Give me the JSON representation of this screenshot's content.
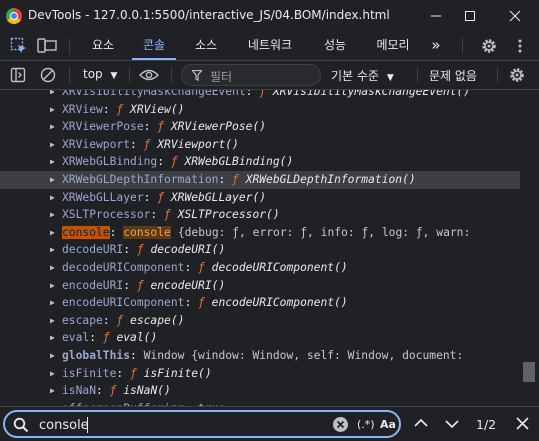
{
  "window": {
    "title": "DevTools - 127.0.0.1:5500/interactive_JS/04.BOM/index.html",
    "icon": "chrome-icon",
    "controls": [
      "minimize-icon",
      "maximize-icon",
      "close-icon"
    ]
  },
  "tabs": {
    "items": [
      {
        "label": "요소",
        "active": false
      },
      {
        "label": "콘솔",
        "active": true
      },
      {
        "label": "소스",
        "active": false
      },
      {
        "label": "네트워크",
        "active": false
      },
      {
        "label": "성능",
        "active": false
      },
      {
        "label": "메모리",
        "active": false
      }
    ],
    "more": "»"
  },
  "toolbar": {
    "context": "top",
    "filter_placeholder": "필터",
    "levels": "기본 수준",
    "issues": "문제 없음"
  },
  "console_rows": [
    {
      "name": "XRVisibilityMaskChangeEvent",
      "fn": "XRVisibilityMaskChangeEvent()",
      "partial": true
    },
    {
      "name": "XRView",
      "fn": "XRView()"
    },
    {
      "name": "XRViewerPose",
      "fn": "XRViewerPose()"
    },
    {
      "name": "XRViewport",
      "fn": "XRViewport()"
    },
    {
      "name": "XRWebGLBinding",
      "fn": "XRWebGLBinding()"
    },
    {
      "name": "XRWebGLDepthInformation",
      "fn": "XRWebGLDepthInformation()",
      "highlight": true
    },
    {
      "name": "XRWebGLLayer",
      "fn": "XRWebGLLayer()"
    },
    {
      "name": "XSLTProcessor",
      "fn": "XSLTProcessor()"
    },
    {
      "name": "console",
      "value": "console",
      "rest": "{debug: ƒ, error: ƒ, info: ƒ, log: ƒ, warn:",
      "match": true
    },
    {
      "name": "decodeURI",
      "fn": "decodeURI()"
    },
    {
      "name": "decodeURIComponent",
      "fn": "decodeURIComponent()"
    },
    {
      "name": "encodeURI",
      "fn": "encodeURI()"
    },
    {
      "name": "encodeURIComponent",
      "fn": "encodeURIComponent()"
    },
    {
      "name": "escape",
      "fn": "escape()"
    },
    {
      "name": "eval",
      "fn": "eval()"
    },
    {
      "name": "globalThis",
      "plain": "Window {window: Window, self: Window, document:",
      "bold": true
    },
    {
      "name": "isFinite",
      "fn": "isFinite()"
    },
    {
      "name": "isNaN",
      "fn": "isNaN()"
    },
    {
      "name": "offscreenBuffering",
      "plain": "true",
      "partial": true
    }
  ],
  "search": {
    "value": "console",
    "clear_icon": "clear-icon",
    "regex_label": "(.*)",
    "case_label": "Aa",
    "count": "1/2"
  }
}
